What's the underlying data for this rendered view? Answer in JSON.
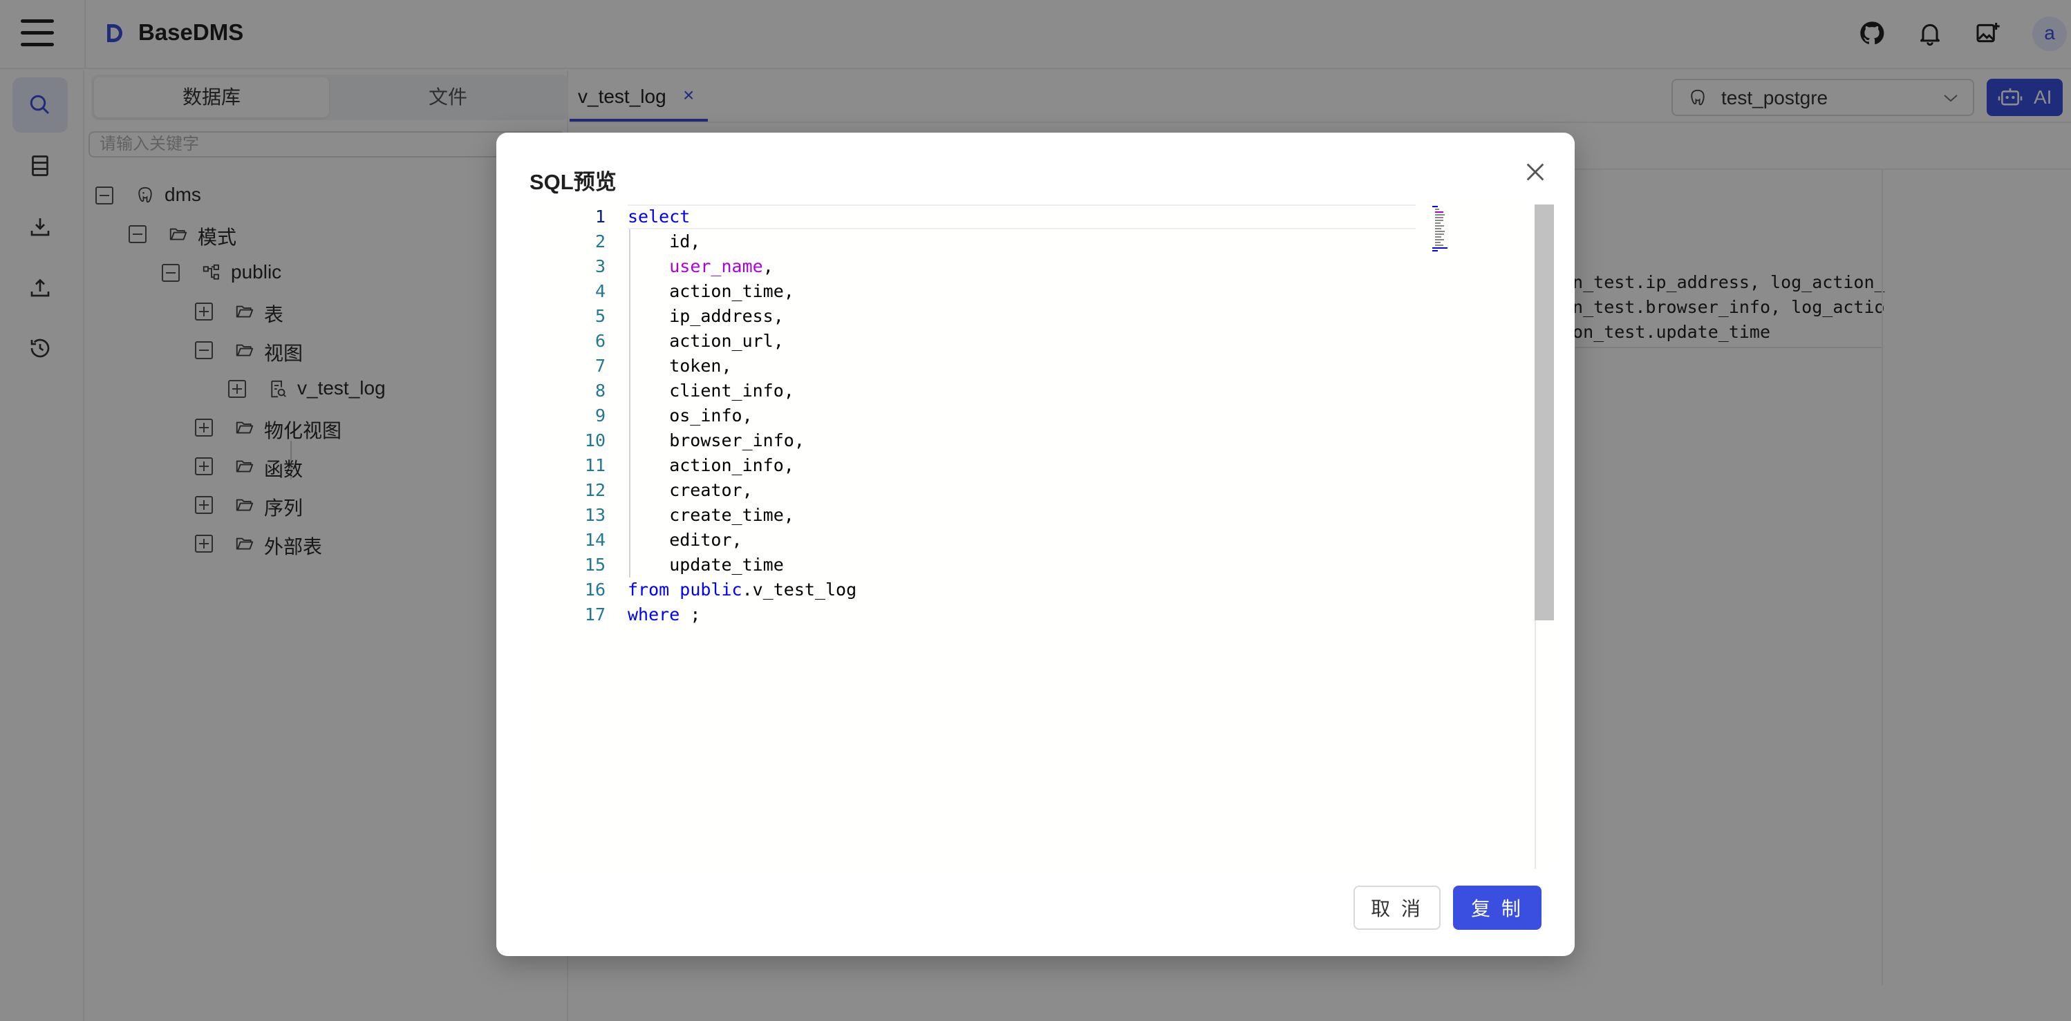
{
  "app": {
    "title": "BaseDMS",
    "avatar_letter": "a"
  },
  "header": {
    "icons": [
      "github-icon",
      "bell-icon",
      "image-upload-icon"
    ]
  },
  "rail": {
    "items": [
      "search-icon",
      "database-icon",
      "download-icon",
      "upload-icon",
      "history-icon"
    ],
    "active": "search-icon"
  },
  "side": {
    "tabs": [
      "数据库",
      "文件"
    ],
    "search_placeholder": "请输入关键字",
    "tree": [
      {
        "label": "dms",
        "type": "postgres-icon",
        "expanded": true
      },
      {
        "label": "模式",
        "type": "folder-open-icon",
        "expanded": true
      },
      {
        "label": "public",
        "type": "schema-icon",
        "expanded": true
      },
      {
        "label": "表",
        "type": "folder-open-icon",
        "expanded": false
      },
      {
        "label": "视图",
        "type": "folder-open-icon",
        "expanded": true
      },
      {
        "label": "v_test_log",
        "type": "view-icon",
        "expanded": false
      },
      {
        "label": "物化视图",
        "type": "folder-open-icon",
        "expanded": false
      },
      {
        "label": "函数",
        "type": "folder-open-icon",
        "expanded": false
      },
      {
        "label": "序列",
        "type": "folder-open-icon",
        "expanded": false
      },
      {
        "label": "外部表",
        "type": "folder-open-icon",
        "expanded": false
      }
    ]
  },
  "main": {
    "tab": {
      "label": "v_test_log",
      "close": "×"
    },
    "database": "test_postgre",
    "ai_label": "AI",
    "background_code": [
      "on_test.ip_address, log_action_",
      "on_test.browser_info, log_actio",
      "ion_test.update_time"
    ]
  },
  "modal": {
    "title": "SQL预览",
    "code_lines": [
      [
        {
          "t": "select",
          "c": "kw"
        }
      ],
      [
        {
          "t": "    id,"
        }
      ],
      [
        {
          "t": "    "
        },
        {
          "t": "user_name",
          "c": "ident"
        },
        {
          "t": ","
        }
      ],
      [
        {
          "t": "    action_time,"
        }
      ],
      [
        {
          "t": "    ip_address,"
        }
      ],
      [
        {
          "t": "    action_url,"
        }
      ],
      [
        {
          "t": "    token,"
        }
      ],
      [
        {
          "t": "    client_info,"
        }
      ],
      [
        {
          "t": "    os_info,"
        }
      ],
      [
        {
          "t": "    browser_info,"
        }
      ],
      [
        {
          "t": "    action_info,"
        }
      ],
      [
        {
          "t": "    creator,"
        }
      ],
      [
        {
          "t": "    create_time,"
        }
      ],
      [
        {
          "t": "    editor,"
        }
      ],
      [
        {
          "t": "    update_time"
        }
      ],
      [
        {
          "t": "from",
          "c": "kw"
        },
        {
          "t": " "
        },
        {
          "t": "public",
          "c": "kw"
        },
        {
          "t": ".v_test_log"
        }
      ],
      [
        {
          "t": "where",
          "c": "kw"
        },
        {
          "t": " ;"
        }
      ]
    ],
    "cancel_label": "取 消",
    "copy_label": "复 制"
  },
  "colors": {
    "accent": "#3a4fe0",
    "keyword": "#0000ff",
    "identifier": "#af00db",
    "line_number": "#237893"
  }
}
